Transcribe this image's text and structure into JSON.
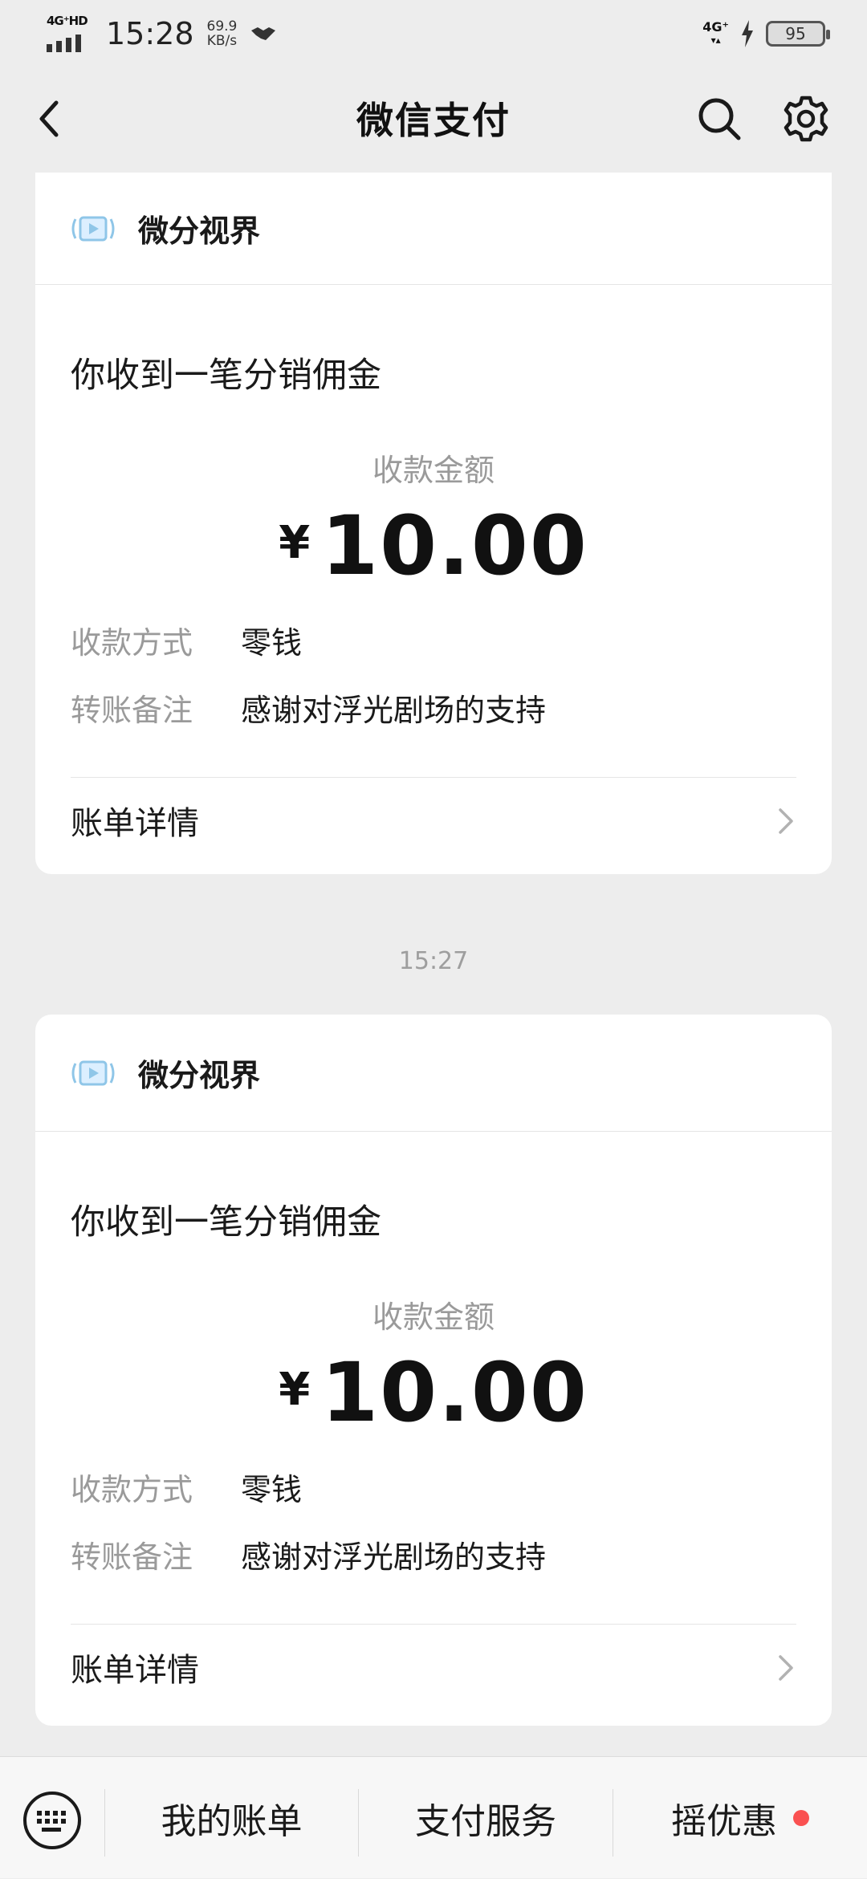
{
  "status_bar": {
    "network_label": "4G⁺HD",
    "time": "15:28",
    "speed_value": "69.9",
    "speed_unit": "KB/s",
    "right_network": "4G⁺",
    "battery": "95"
  },
  "nav": {
    "title": "微信支付",
    "icons": [
      "back-icon",
      "search-icon",
      "gear-icon"
    ]
  },
  "messages": [
    {
      "app_name": "微分视界",
      "title": "你收到一笔分销佣金",
      "amount_label": "收款金额",
      "currency": "¥",
      "amount": "10.00",
      "method_key": "收款方式",
      "method_value": "零钱",
      "note_key": "转账备注",
      "note_value": "感谢对浮光剧场的支持",
      "detail_label": "账单详情"
    },
    {
      "app_name": "微分视界",
      "title": "你收到一笔分销佣金",
      "amount_label": "收款金额",
      "currency": "¥",
      "amount": "10.00",
      "method_key": "收款方式",
      "method_value": "零钱",
      "note_key": "转账备注",
      "note_value": "感谢对浮光剧场的支持",
      "detail_label": "账单详情"
    }
  ],
  "timestamp": "15:27",
  "bottom_tabs": {
    "bills": "我的账单",
    "services": "支付服务",
    "shake": "摇优惠"
  },
  "colors": {
    "background": "#ededed",
    "card": "#ffffff",
    "muted_text": "#9a9a9a",
    "red_dot": "#fa5151"
  }
}
